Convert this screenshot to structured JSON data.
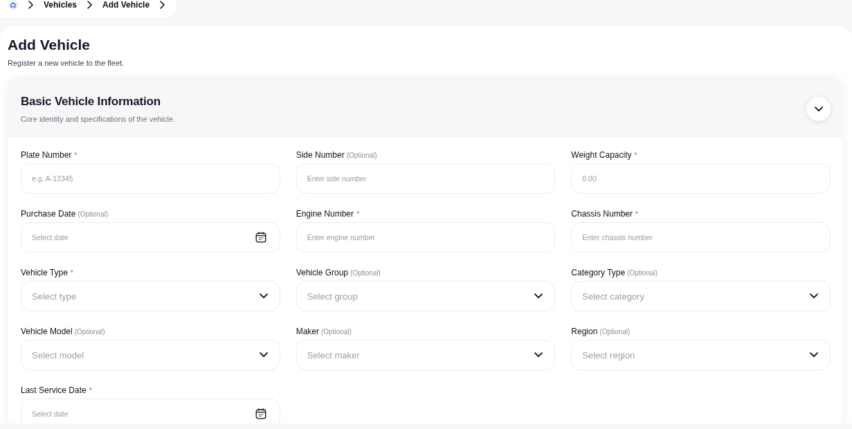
{
  "breadcrumb": {
    "items": [
      {
        "kind": "home"
      },
      {
        "kind": "link",
        "label": "Vehicles"
      },
      {
        "kind": "link",
        "label": "Add Vehicle"
      }
    ]
  },
  "page": {
    "title": "Add Vehicle",
    "subtitle": "Register a new vehicle to the fleet."
  },
  "section": {
    "title": "Basic Vehicle Information",
    "subtitle": "Core identity and specifications of the vehicle.",
    "expanded": true,
    "fields": [
      {
        "label": "Plate Number",
        "tag": {
          "kind": "required",
          "text": "*"
        },
        "kind": "text",
        "placeholder": "e.g. A-12345"
      },
      {
        "label": "Side Number",
        "tag": {
          "kind": "optional",
          "text": "(Optional)"
        },
        "kind": "text",
        "placeholder": "Enter side number"
      },
      {
        "label": "Weight Capacity",
        "tag": {
          "kind": "required",
          "text": "*"
        },
        "kind": "text",
        "placeholder": "0.00"
      },
      {
        "label": "Purchase Date",
        "tag": {
          "kind": "optional",
          "text": "(Optional)"
        },
        "kind": "date",
        "placeholder": "Select date"
      },
      {
        "label": "Engine Number",
        "tag": {
          "kind": "required",
          "text": "*"
        },
        "kind": "text",
        "placeholder": "Enter engine number"
      },
      {
        "label": "Chassis Number",
        "tag": {
          "kind": "required",
          "text": "*"
        },
        "kind": "text",
        "placeholder": "Enter chassis number"
      },
      {
        "label": "Vehicle Type",
        "tag": {
          "kind": "required",
          "text": "*"
        },
        "kind": "select",
        "placeholder": "Select type"
      },
      {
        "label": "Vehicle Group",
        "tag": {
          "kind": "optional",
          "text": "(Optional)"
        },
        "kind": "select",
        "placeholder": "Select group"
      },
      {
        "label": "Category Type",
        "tag": {
          "kind": "optional",
          "text": "(Optional)"
        },
        "kind": "select",
        "placeholder": "Select category"
      },
      {
        "label": "Vehicle Model",
        "tag": {
          "kind": "optional",
          "text": "(Optional)"
        },
        "kind": "select",
        "placeholder": "Select model"
      },
      {
        "label": "Maker",
        "tag": {
          "kind": "optional",
          "text": "(Optional)"
        },
        "kind": "select",
        "placeholder": "Select maker"
      },
      {
        "label": "Region",
        "tag": {
          "kind": "optional",
          "text": "(Optional)"
        },
        "kind": "select",
        "placeholder": "Select region"
      },
      {
        "label": "Last Service Date",
        "tag": {
          "kind": "required",
          "text": "*"
        },
        "kind": "date",
        "placeholder": "Select date"
      }
    ]
  }
}
